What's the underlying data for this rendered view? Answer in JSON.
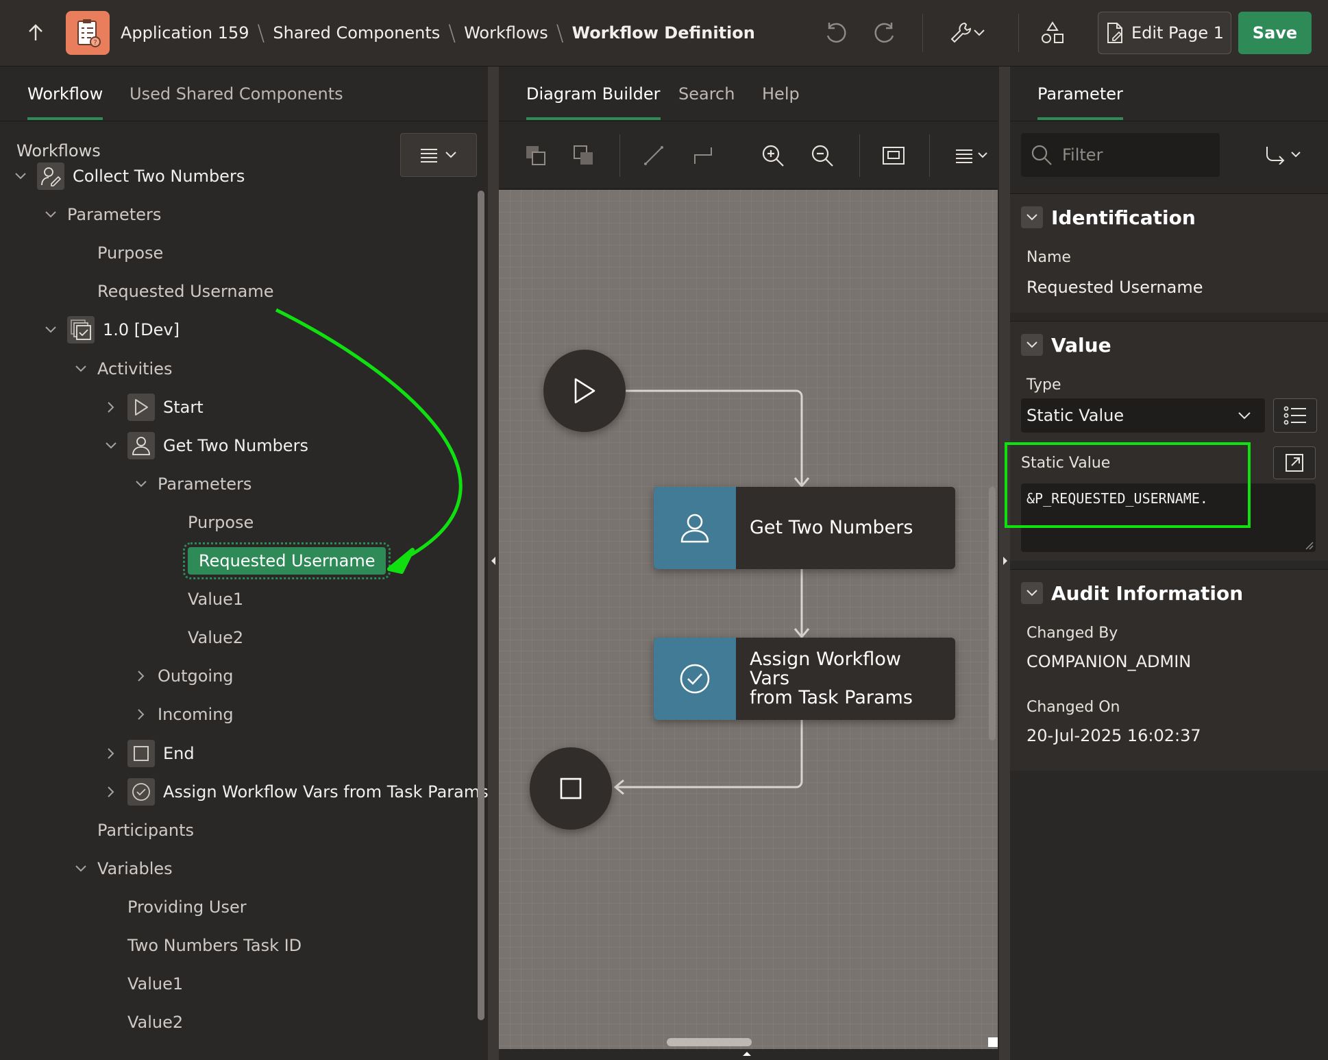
{
  "header": {
    "breadcrumbs": [
      "Application 159",
      "Shared Components",
      "Workflows",
      "Workflow Definition"
    ],
    "edit_page_label": "Edit Page 1",
    "save_label": "Save",
    "icons": [
      "up-arrow-icon",
      "undo-icon",
      "redo-icon",
      "wrench-icon",
      "shared-components-icon",
      "page-icon"
    ]
  },
  "left_tabs": [
    "Workflow",
    "Used Shared Components"
  ],
  "center_tabs": [
    "Diagram Builder",
    "Search",
    "Help"
  ],
  "right_tabs": [
    "Parameter"
  ],
  "tree": {
    "title": "Workflows",
    "rows": [
      {
        "label": "Collect Two Numbers",
        "indent": 0,
        "toggle": "down",
        "icon": "workflow-icon",
        "kind": "parent"
      },
      {
        "label": "Parameters",
        "indent": 1,
        "toggle": "down",
        "icon": null,
        "kind": "leaf"
      },
      {
        "label": "Purpose",
        "indent": 2,
        "toggle": null,
        "icon": null,
        "kind": "leaf"
      },
      {
        "label": "Requested Username",
        "indent": 2,
        "toggle": null,
        "icon": null,
        "kind": "leaf"
      },
      {
        "label": "1.0 [Dev]",
        "indent": 1,
        "toggle": "down",
        "icon": "version-icon",
        "kind": "parent"
      },
      {
        "label": "Activities",
        "indent": 2,
        "toggle": "down",
        "icon": null,
        "kind": "leaf"
      },
      {
        "label": "Start",
        "indent": 3,
        "toggle": "right",
        "icon": "start-icon",
        "kind": "parent"
      },
      {
        "label": "Get Two Numbers",
        "indent": 3,
        "toggle": "down",
        "icon": "user-icon",
        "kind": "parent"
      },
      {
        "label": "Parameters",
        "indent": 4,
        "toggle": "down",
        "icon": null,
        "kind": "leaf"
      },
      {
        "label": "Purpose",
        "indent": 5,
        "toggle": null,
        "icon": null,
        "kind": "leaf"
      },
      {
        "label": "Requested Username",
        "indent": 5,
        "toggle": null,
        "icon": null,
        "kind": "selected"
      },
      {
        "label": "Value1",
        "indent": 5,
        "toggle": null,
        "icon": null,
        "kind": "leaf"
      },
      {
        "label": "Value2",
        "indent": 5,
        "toggle": null,
        "icon": null,
        "kind": "leaf"
      },
      {
        "label": "Outgoing",
        "indent": 4,
        "toggle": "right",
        "icon": null,
        "kind": "leaf"
      },
      {
        "label": "Incoming",
        "indent": 4,
        "toggle": "right",
        "icon": null,
        "kind": "leaf"
      },
      {
        "label": "End",
        "indent": 3,
        "toggle": "right",
        "icon": "end-icon",
        "kind": "parent"
      },
      {
        "label": "Assign Workflow Vars from Task Params",
        "indent": 3,
        "toggle": "right",
        "icon": "check-icon",
        "kind": "parent"
      },
      {
        "label": "Participants",
        "indent": 2,
        "toggle": null,
        "icon": null,
        "kind": "leaf"
      },
      {
        "label": "Variables",
        "indent": 2,
        "toggle": "down",
        "icon": null,
        "kind": "leaf"
      },
      {
        "label": "Providing User",
        "indent": 3,
        "toggle": null,
        "icon": null,
        "kind": "leaf"
      },
      {
        "label": "Two Numbers Task ID",
        "indent": 3,
        "toggle": null,
        "icon": null,
        "kind": "leaf"
      },
      {
        "label": "Value1",
        "indent": 3,
        "toggle": null,
        "icon": null,
        "kind": "leaf"
      },
      {
        "label": "Value2",
        "indent": 3,
        "toggle": null,
        "icon": null,
        "kind": "leaf"
      }
    ]
  },
  "diagram": {
    "nodes": [
      {
        "type": "start",
        "icon": "play-icon"
      },
      {
        "type": "human-task",
        "label": "Get Two Numbers",
        "icon": "user-icon"
      },
      {
        "type": "activity",
        "label": "Assign Workflow Vars\nfrom Task Params",
        "icon": "check-circle-icon"
      },
      {
        "type": "end",
        "icon": "stop-icon"
      }
    ]
  },
  "properties": {
    "filter_placeholder": "Filter",
    "identification": {
      "title": "Identification",
      "name_label": "Name",
      "name_value": "Requested Username"
    },
    "value": {
      "title": "Value",
      "type_label": "Type",
      "type_value": "Static Value",
      "static_label": "Static Value",
      "static_value": "&P_REQUESTED_USERNAME."
    },
    "audit": {
      "title": "Audit Information",
      "changed_by_label": "Changed By",
      "changed_by_value": "COMPANION_ADMIN",
      "changed_on_label": "Changed On",
      "changed_on_value": "20-Jul-2025 16:02:37"
    }
  },
  "colors": {
    "accent_green": "#2e8a57",
    "highlight_green": "#10e010",
    "node_blue": "#427b96",
    "app_icon": "#e87e5c"
  }
}
